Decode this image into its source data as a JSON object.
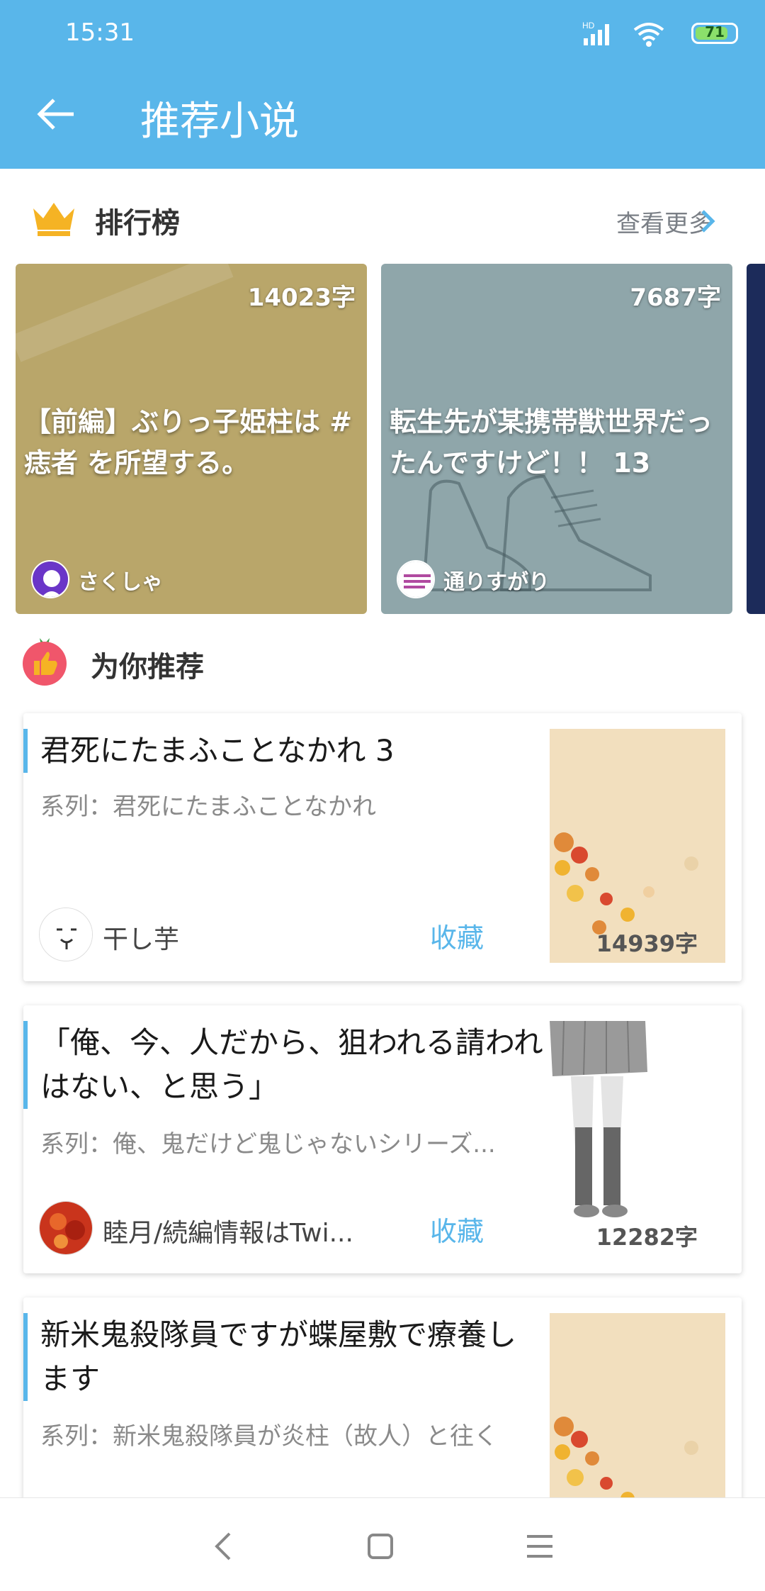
{
  "status_bar": {
    "time": "15:31",
    "network": "HD",
    "battery": "71"
  },
  "app_bar": {
    "title": "推荐小说",
    "back_icon": "back-arrow-icon"
  },
  "ranking": {
    "title": "排行榜",
    "more_label": "查看更多",
    "cards": [
      {
        "count": "14023字",
        "title": "【前編】ぶりっ子姫柱は # 痣者 を所望する。",
        "author": "さくしゃ",
        "bg_color": "#b9a66a"
      },
      {
        "count": "7687字",
        "title": "転生先が某携帯獣世界だったんですけど！！ 13",
        "author": "通りすがり",
        "bg_color": "#8fa6aa"
      }
    ]
  },
  "recommend": {
    "title": "为你推荐",
    "items": [
      {
        "title": "君死にたまふことなかれ 3",
        "series": "系列：君死にたまふことなかれ",
        "author": "干し芋",
        "fav": "收藏",
        "count": "14939字"
      },
      {
        "title": "「俺、今、人だから、狙われる請われはない、と思う」",
        "series": "系列：俺、鬼だけど鬼じゃないシリーズ...",
        "author": "睦月/続編情報はTwi...",
        "fav": "收藏",
        "count": "12282字"
      },
      {
        "title": "新米鬼殺隊員ですが蝶屋敷で療養します",
        "series": "系列：新米鬼殺隊員が炎柱（故人）と往く",
        "author": "",
        "fav": "",
        "count": ""
      }
    ]
  },
  "colors": {
    "accent": "#59b6ea",
    "crown": "#f5b324",
    "tomato": "#f0566b"
  },
  "nav": [
    "back-nav-icon",
    "home-nav-icon",
    "menu-nav-icon"
  ]
}
